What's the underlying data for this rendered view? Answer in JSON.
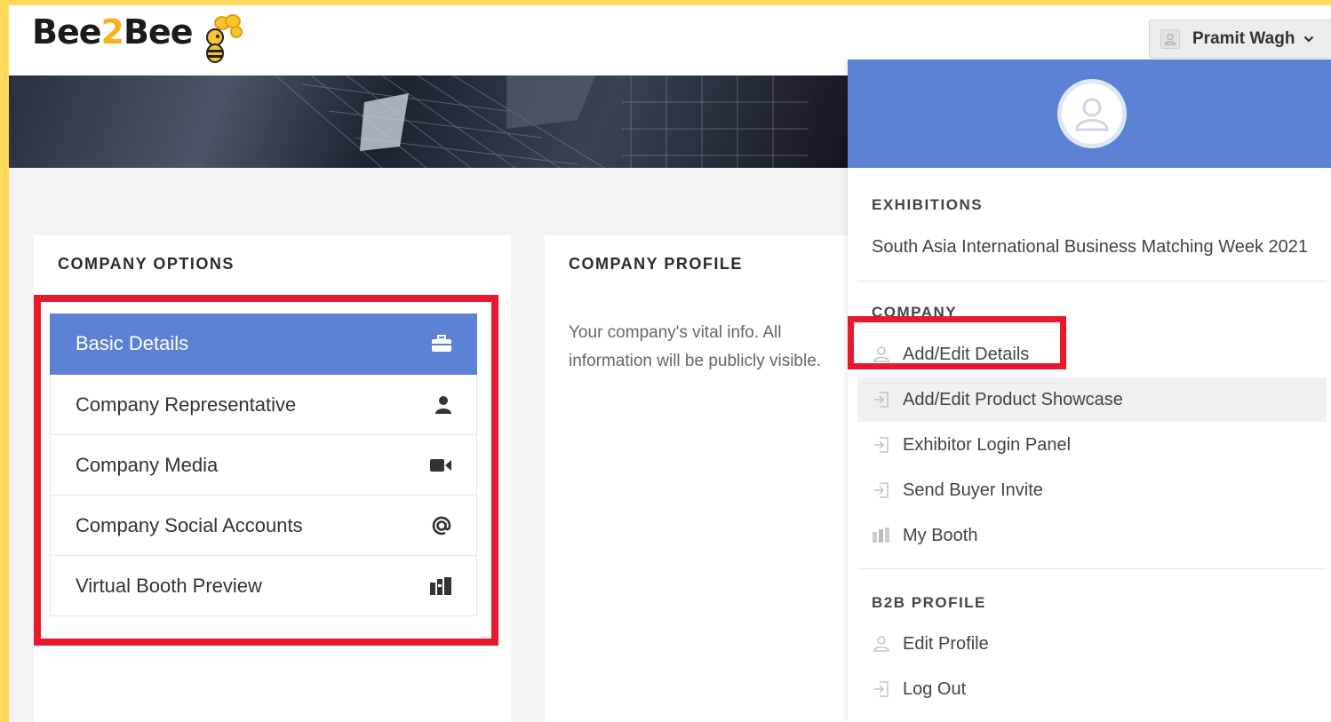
{
  "header": {
    "logo_left": "Bee",
    "logo_mid": "2",
    "logo_right": "Bee",
    "user_name": "Pramit Wagh"
  },
  "company_options": {
    "title": "COMPANY OPTIONS",
    "items": [
      {
        "label": "Basic Details",
        "icon": "briefcase-icon",
        "active": true
      },
      {
        "label": "Company Representative",
        "icon": "user-icon"
      },
      {
        "label": "Company Media",
        "icon": "video-camera-icon"
      },
      {
        "label": "Company Social Accounts",
        "icon": "at-sign-icon"
      },
      {
        "label": "Virtual Booth Preview",
        "icon": "booth-icon"
      }
    ]
  },
  "company_profile": {
    "title": "COMPANY PROFILE",
    "description": "Your company's vital info. All information will be publicly visible."
  },
  "dropdown": {
    "exhibitions_label": "EXHIBITIONS",
    "exhibition_name": "South Asia International Business Matching Week 2021",
    "company_label": "COMPANY",
    "company_items": [
      {
        "label": "Add/Edit Details",
        "icon": "user-outline-icon"
      },
      {
        "label": "Add/Edit Product Showcase",
        "icon": "login-arrow-icon"
      },
      {
        "label": "Exhibitor Login Panel",
        "icon": "login-arrow-icon"
      },
      {
        "label": "Send Buyer Invite",
        "icon": "login-arrow-icon"
      },
      {
        "label": "My Booth",
        "icon": "booth-icon"
      }
    ],
    "b2b_label": "B2B PROFILE",
    "b2b_items": [
      {
        "label": "Edit Profile",
        "icon": "user-outline-icon"
      },
      {
        "label": "Log Out",
        "icon": "login-arrow-icon"
      }
    ]
  },
  "colors": {
    "accent": "#5b82d5",
    "highlight": "#e8192c",
    "frame": "#ffd957"
  }
}
